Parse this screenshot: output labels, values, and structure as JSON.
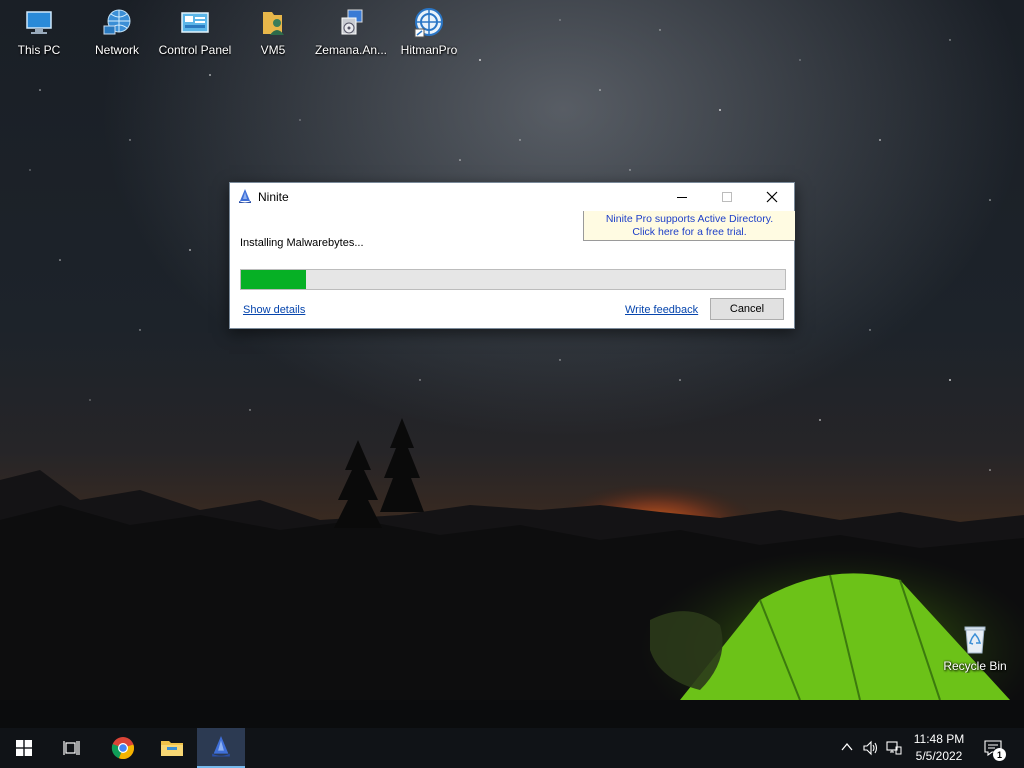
{
  "desktop": {
    "icons": [
      {
        "label": "This PC",
        "icon": "this-pc-icon"
      },
      {
        "label": "Network",
        "icon": "network-icon"
      },
      {
        "label": "Control Panel",
        "icon": "control-panel-icon"
      },
      {
        "label": "VM5",
        "icon": "user-folder-icon"
      },
      {
        "label": "Zemana.An...",
        "icon": "installer-icon"
      },
      {
        "label": "HitmanPro",
        "icon": "hitmanpro-icon"
      },
      {
        "label": "Recycle Bin",
        "icon": "recycle-bin-icon"
      }
    ]
  },
  "window": {
    "title": "Ninite",
    "promo_line1": "Ninite Pro supports Active Directory.",
    "promo_line2": "Click here for a free trial.",
    "status": "Installing Malwarebytes...",
    "progress_fraction": 0.12,
    "show_details": "Show details",
    "write_feedback": "Write feedback",
    "cancel": "Cancel"
  },
  "taskbar": {
    "time": "11:48 PM",
    "date": "5/5/2022",
    "notification_count": "1",
    "apps": [
      "start-icon",
      "task-view-icon",
      "chrome-icon",
      "file-explorer-icon",
      "ninite-icon"
    ]
  },
  "colors": {
    "progress_fill": "#06b025",
    "link": "#0645ad",
    "promo_text": "#1e3fc8",
    "promo_bg": "#fffbe2"
  }
}
